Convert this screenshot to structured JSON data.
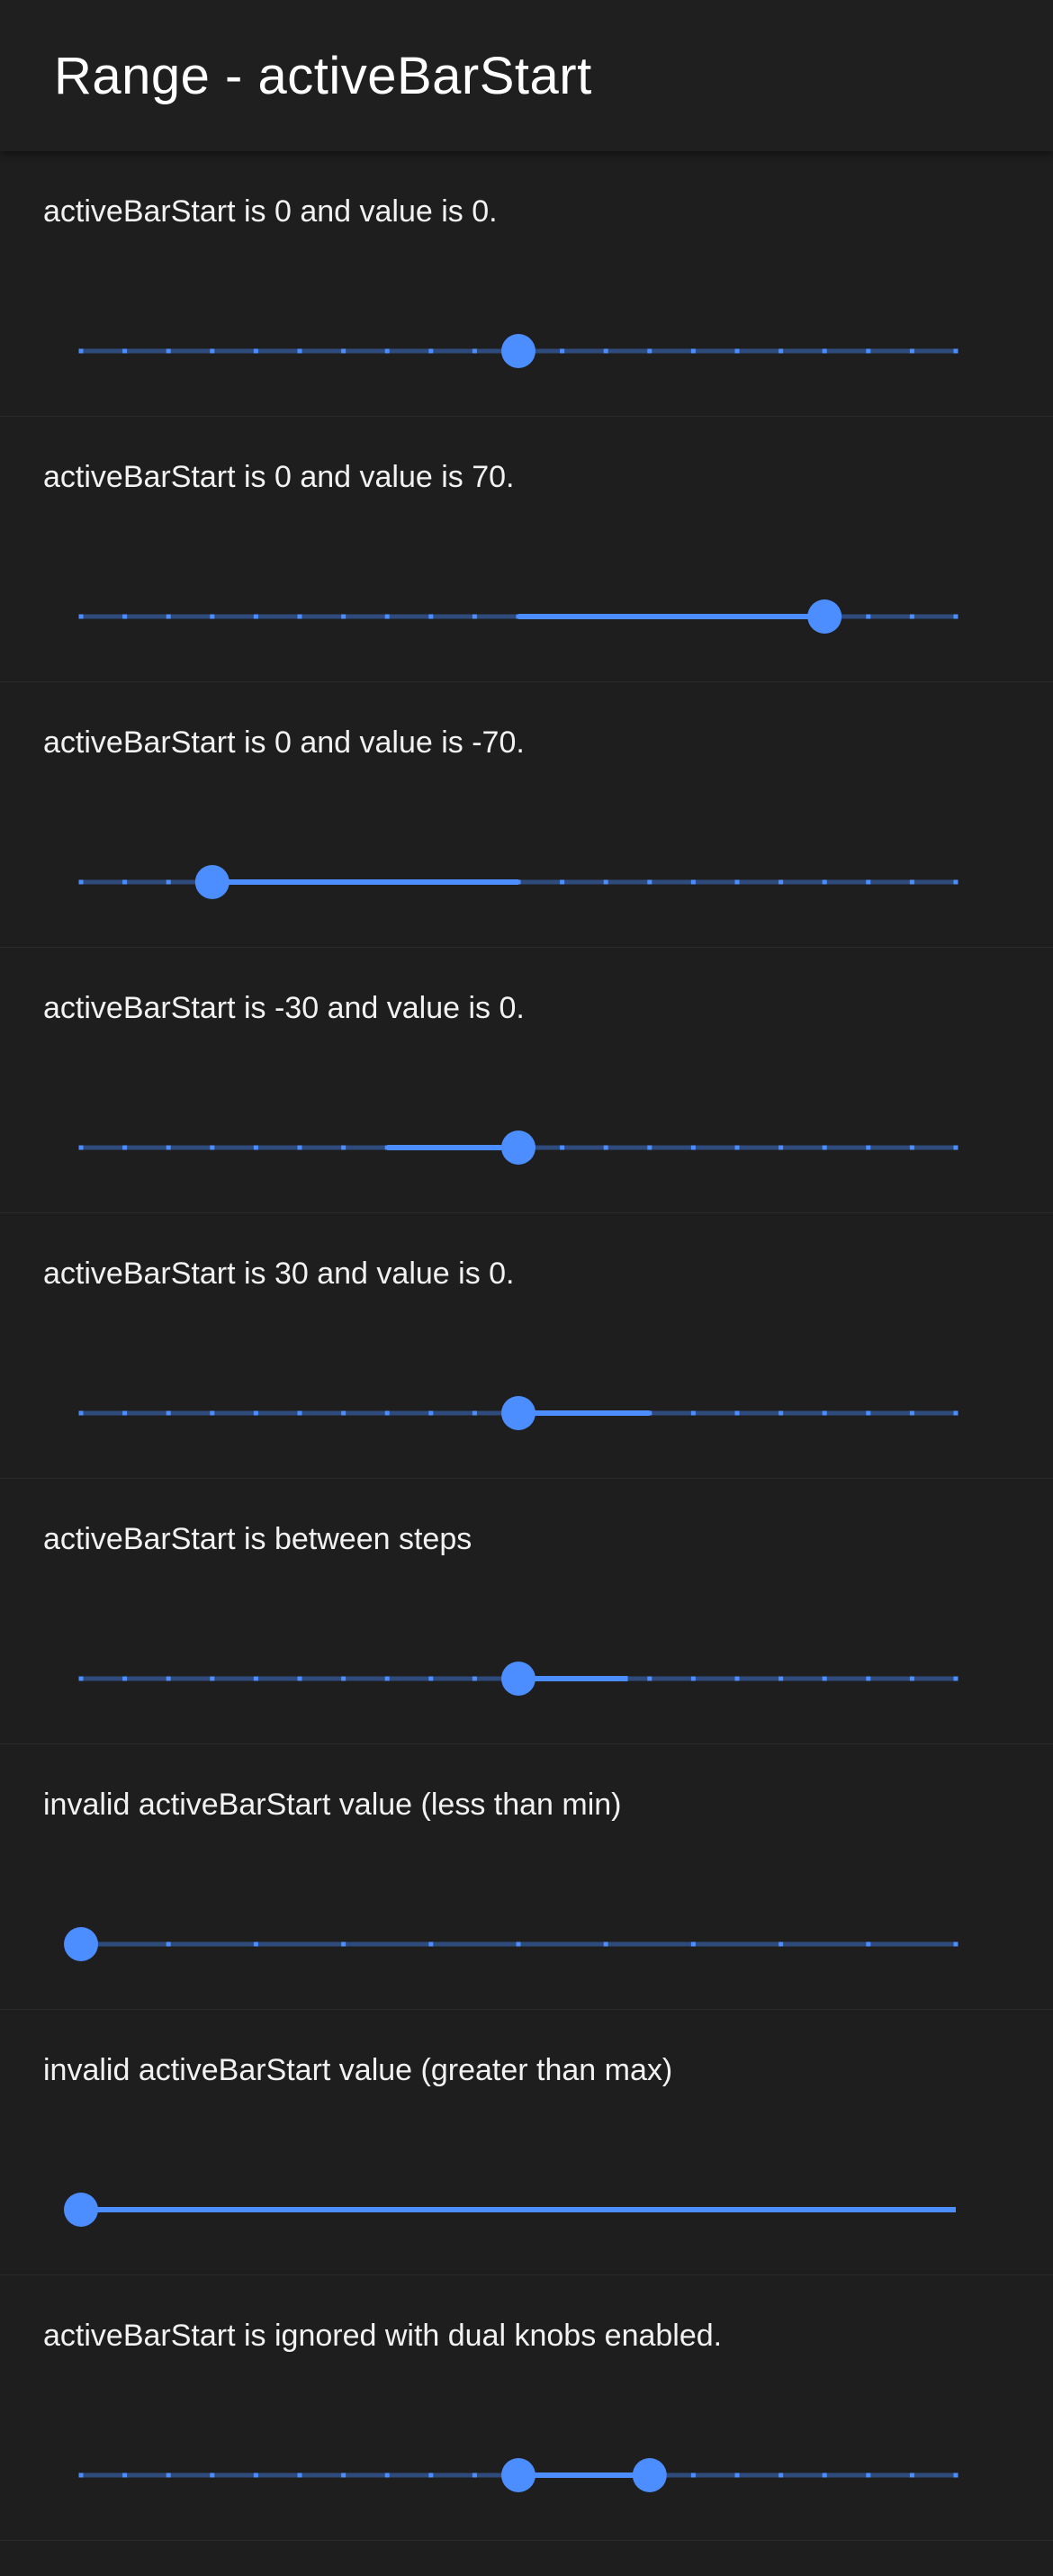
{
  "page": {
    "title": "Range - activeBarStart"
  },
  "colors": {
    "accent": "#4c8dff",
    "track": "#2f4b7c",
    "tick": "#4c8dff",
    "background": "#1e1e1e"
  },
  "ranges": [
    {
      "label": "activeBarStart is 0 and value is 0.",
      "min": -100,
      "max": 100,
      "step": 10,
      "ticks": true,
      "active_bar_start": 0,
      "value": 0
    },
    {
      "label": "activeBarStart is 0 and value is 70.",
      "min": -100,
      "max": 100,
      "step": 10,
      "ticks": true,
      "active_bar_start": 0,
      "value": 70
    },
    {
      "label": "activeBarStart is 0 and value is -70.",
      "min": -100,
      "max": 100,
      "step": 10,
      "ticks": true,
      "active_bar_start": 0,
      "value": -70
    },
    {
      "label": "activeBarStart is -30 and value is 0.",
      "min": -100,
      "max": 100,
      "step": 10,
      "ticks": true,
      "active_bar_start": -30,
      "value": 0
    },
    {
      "label": "activeBarStart is 30 and value is 0.",
      "min": -100,
      "max": 100,
      "step": 10,
      "ticks": true,
      "active_bar_start": 30,
      "value": 0
    },
    {
      "label": "activeBarStart is between steps",
      "min": -100,
      "max": 100,
      "step": 10,
      "ticks": true,
      "active_bar_start": 25,
      "value": 0
    },
    {
      "label": "invalid activeBarStart value (less than min)",
      "min": 0,
      "max": 100,
      "step": 10,
      "ticks": true,
      "active_bar_start": 0,
      "value": 0
    },
    {
      "label": "invalid activeBarStart value (greater than max)",
      "min": 0,
      "max": 100,
      "step": 10,
      "ticks": false,
      "active_bar_start": 100,
      "value": 0
    },
    {
      "label": "activeBarStart is ignored with dual knobs enabled.",
      "min": -100,
      "max": 100,
      "step": 10,
      "ticks": true,
      "dual_knobs": true,
      "lower": 0,
      "upper": 30
    }
  ]
}
